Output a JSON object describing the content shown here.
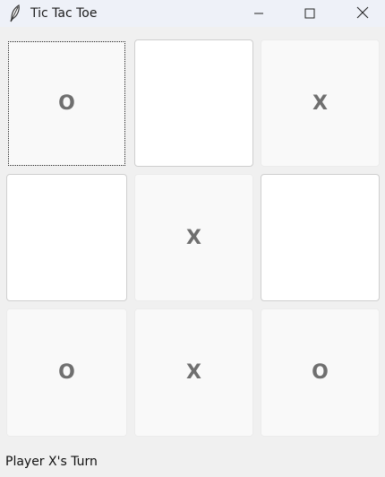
{
  "window": {
    "title": "Tic Tac Toe",
    "icon": "feather-icon"
  },
  "board": {
    "cells": [
      {
        "mark": "O",
        "state": "filled",
        "focused": true
      },
      {
        "mark": "",
        "state": "empty",
        "focused": false
      },
      {
        "mark": "X",
        "state": "filled",
        "focused": false
      },
      {
        "mark": "",
        "state": "empty",
        "focused": false
      },
      {
        "mark": "X",
        "state": "filled",
        "focused": false
      },
      {
        "mark": "",
        "state": "empty",
        "focused": false
      },
      {
        "mark": "O",
        "state": "filled",
        "focused": false
      },
      {
        "mark": "X",
        "state": "filled",
        "focused": false
      },
      {
        "mark": "O",
        "state": "filled",
        "focused": false
      }
    ]
  },
  "status": {
    "text": "Player X's Turn"
  }
}
